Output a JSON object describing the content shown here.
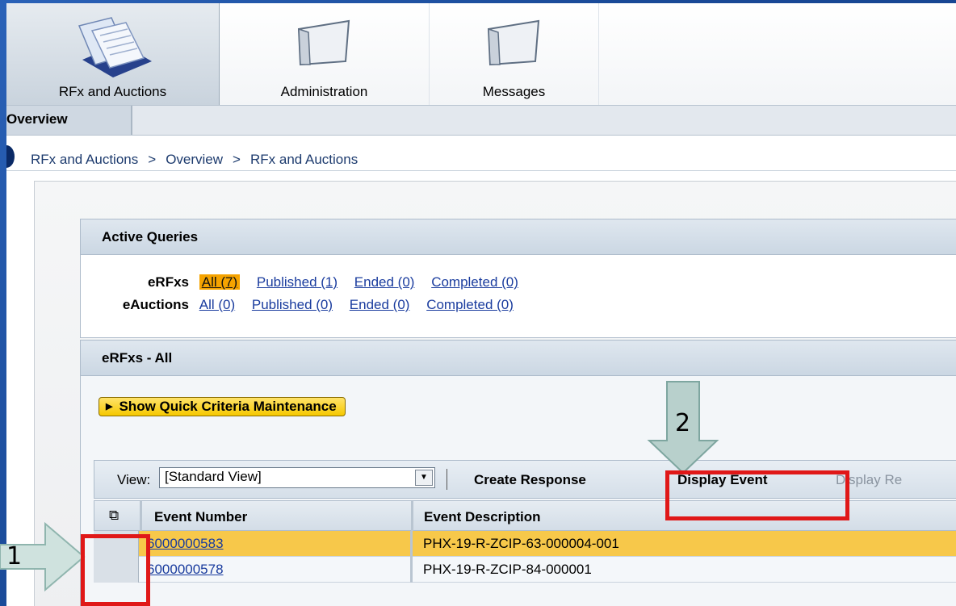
{
  "tabs": [
    {
      "label": "RFx and Auctions",
      "icon": "documents-icon",
      "active": true
    },
    {
      "label": "Administration",
      "icon": "folder-icon",
      "active": false
    },
    {
      "label": "Messages",
      "icon": "folder-icon",
      "active": false
    }
  ],
  "subnav": {
    "overview": "Overview"
  },
  "breadcrumb": [
    "RFx and Auctions",
    ">",
    "Overview",
    ">",
    "RFx and Auctions"
  ],
  "active_queries": {
    "title": "Active Queries",
    "erfxs": {
      "label": "eRFxs",
      "all": "All (7)",
      "published": "Published (1)",
      "ended": "Ended (0)",
      "completed": "Completed (0)"
    },
    "eauctions": {
      "label": "eAuctions",
      "all": "All (0)",
      "published": "Published (0)",
      "ended": "Ended (0)",
      "completed": "Completed (0)"
    }
  },
  "list": {
    "title": "eRFxs - All",
    "quick_criteria": "Show Quick Criteria Maintenance",
    "toolbar": {
      "view_label": "View:",
      "view_value": "[Standard View]",
      "create_response": "Create Response",
      "display_event": "Display Event",
      "display_response": "Display Re"
    },
    "columns": {
      "event_number": "Event Number",
      "event_description": "Event Description"
    },
    "rows": [
      {
        "event_number": "6000000583",
        "event_description": "PHX-19-R-ZCIP-63-000004-001"
      },
      {
        "event_number": "6000000578",
        "event_description": "PHX-19-R-ZCIP-84-000001"
      }
    ]
  },
  "annotations": {
    "step1": "1",
    "step2": "2"
  },
  "colors": {
    "highlight_row": "#f7c84a",
    "selected_query": "#f5a300",
    "annotation_red": "#e01818",
    "annotation_arrow": "#b8d0cc"
  }
}
